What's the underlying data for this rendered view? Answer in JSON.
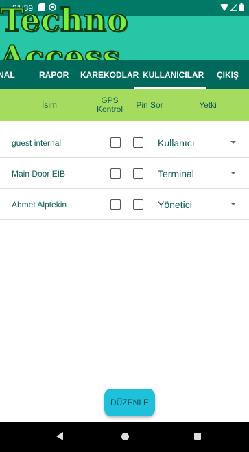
{
  "status_bar": {
    "time": "21:39",
    "icons": [
      "sd-card-icon",
      "hotspot-icon",
      "wifi-icon",
      "signal-icon",
      "battery-icon"
    ]
  },
  "app": {
    "title": "Techno Access",
    "title_color": "#7eec3f",
    "logo_background": "#26c6a6"
  },
  "tabs": [
    {
      "label": "NAL",
      "active": false
    },
    {
      "label": "RAPOR",
      "active": false
    },
    {
      "label": "KAREKODLAR",
      "active": false
    },
    {
      "label": "KULLANICILAR",
      "active": true
    },
    {
      "label": "ÇIKIŞ",
      "active": false
    }
  ],
  "table": {
    "headers": {
      "name": "İsim",
      "gps": "GPS Kontrol",
      "pin": "Pin Sor",
      "role": "Yetki"
    },
    "rows": [
      {
        "name": "guest internal",
        "gps_checked": false,
        "pin_checked": false,
        "role": "Kullanıcı"
      },
      {
        "name": "Main Door EIB",
        "gps_checked": false,
        "pin_checked": false,
        "role": "Terminal"
      },
      {
        "name": "Ahmet Alptekin",
        "gps_checked": false,
        "pin_checked": false,
        "role": "Yönetici"
      }
    ]
  },
  "edit_button": {
    "label": "DÜZENLE",
    "color": "#1ec1d9"
  },
  "colors": {
    "status_bar": "#007a66",
    "tab_bar": "#00695c",
    "header_row": "#a5dc5f"
  }
}
